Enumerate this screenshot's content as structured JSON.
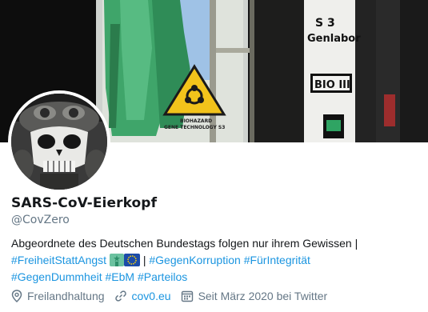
{
  "banner": {
    "sign_room": "S 3",
    "sign_lab": "Genlabor",
    "sign_level": "BIO III",
    "hazard_line1": "BIOHAZARD",
    "hazard_line2": "GENE TECHNOLOGY S3"
  },
  "profile": {
    "display_name": "SARS-CoV-Eierkopf",
    "handle": "@CovZero",
    "bio": {
      "line1": "Abgeordnete des Deutschen Bundestags folgen nur ihrem Gewissen |",
      "tag1": "#FreiheitStattAngst",
      "separator": "|",
      "tag2": "#GegenKorruption",
      "tag3": "#FürIntegrität",
      "tag4": "#GegenDummheit",
      "tag5": "#EbM",
      "tag6": "#Parteilos"
    },
    "location": "Freilandhaltung",
    "website": "cov0.eu",
    "joined": "Seit März 2020 bei Twitter"
  },
  "colors": {
    "link": "#1b95e0",
    "secondary_text": "#657786",
    "primary_text": "#14171a"
  },
  "icons": [
    "location-pin-icon",
    "link-icon",
    "calendar-icon",
    "statue-of-liberty-emoji",
    "eu-flag-emoji"
  ]
}
